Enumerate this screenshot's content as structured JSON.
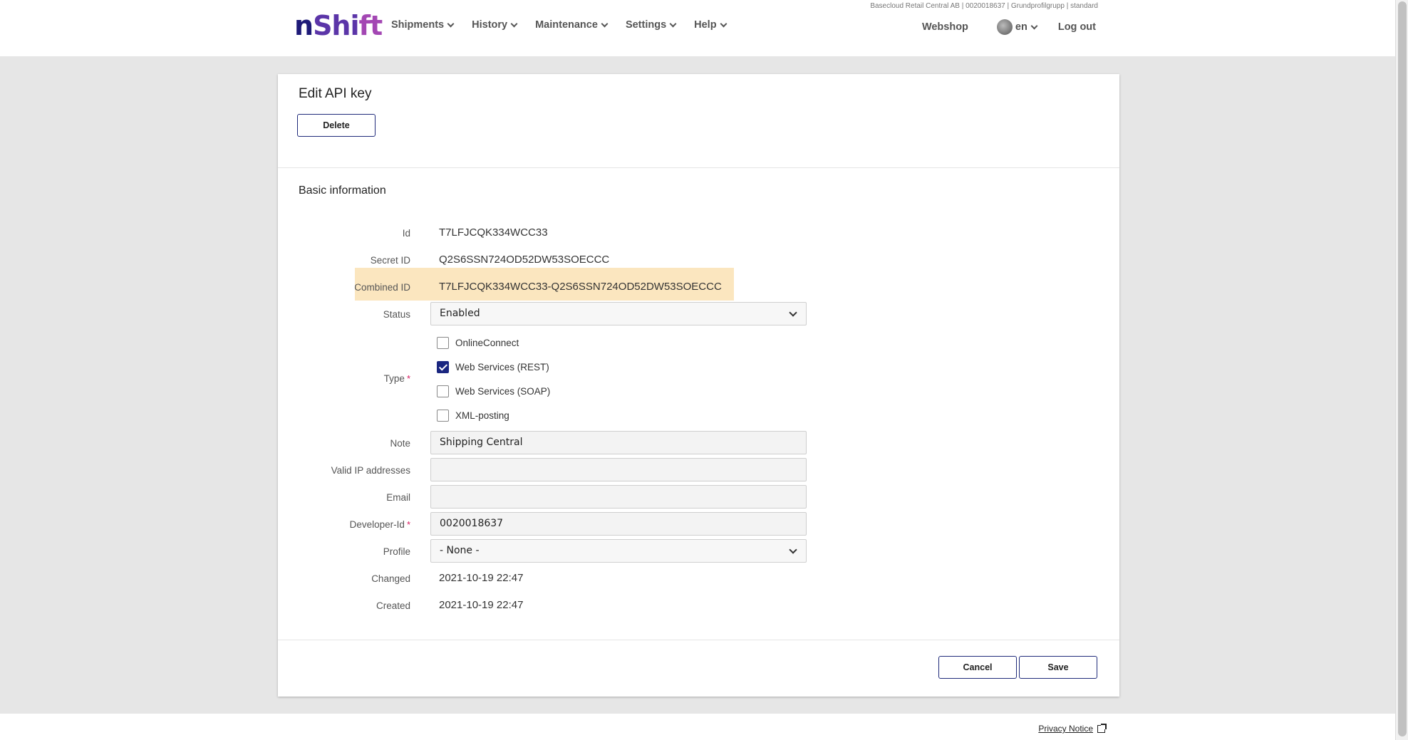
{
  "header": {
    "account_line": "Basecloud Retail Central AB | 0020018637 | Grundprofilgrupp | standard",
    "logo": {
      "n": "n",
      "s": "Shi",
      "ft": "ft"
    },
    "nav": [
      "Shipments",
      "History",
      "Maintenance",
      "Settings",
      "Help"
    ],
    "webshop": "Webshop",
    "language": "en",
    "logout": "Log out"
  },
  "page": {
    "title": "Edit API key",
    "delete_label": "Delete",
    "section_title": "Basic information"
  },
  "form": {
    "id_label": "Id",
    "id_value": "T7LFJCQK334WCC33",
    "secret_label": "Secret ID",
    "secret_value": "Q2S6SSN724OD52DW53SOECCC",
    "combined_label": "Combined ID",
    "combined_value": "T7LFJCQK334WCC33-Q2S6SSN724OD52DW53SOECCC",
    "status_label": "Status",
    "status_value": "Enabled",
    "type_label": "Type",
    "type_required": "*",
    "types": [
      {
        "label": "OnlineConnect",
        "checked": false
      },
      {
        "label": "Web Services (REST)",
        "checked": true
      },
      {
        "label": "Web Services (SOAP)",
        "checked": false
      },
      {
        "label": "XML-posting",
        "checked": false
      }
    ],
    "note_label": "Note",
    "note_value": "Shipping Central",
    "ip_label": "Valid IP addresses",
    "ip_value": "",
    "email_label": "Email",
    "email_value": "",
    "developer_label": "Developer-Id",
    "developer_required": "*",
    "developer_value": "0020018637",
    "profile_label": "Profile",
    "profile_value": "- None -",
    "changed_label": "Changed",
    "changed_value": "2021-10-19 22:47",
    "created_label": "Created",
    "created_value": "2021-10-19 22:47"
  },
  "actions": {
    "cancel_label": "Cancel",
    "save_label": "Save"
  },
  "footer": {
    "privacy_label": "Privacy Notice"
  },
  "colors": {
    "brand": "#1f2a7a",
    "highlight": "#fbe6bf",
    "required": "#d81b60"
  }
}
